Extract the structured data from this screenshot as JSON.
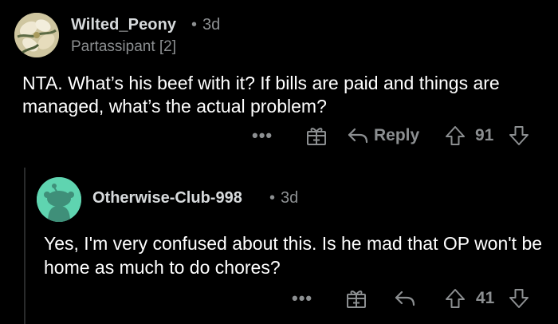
{
  "colors": {
    "background": "#000000",
    "text_primary": "#ffffff",
    "text_secondary": "#8c8f91",
    "reply_avatar_bg": "#5fd4b0"
  },
  "comments": [
    {
      "username": "Wilted_Peony",
      "separator": "•",
      "time": "3d",
      "flair": "Partassipant [2]",
      "body": "NTA. What’s his beef with it? If bills are paid and things are managed, what’s the actual problem?",
      "actions": {
        "more_label": "•••",
        "reply_label": "Reply",
        "vote_count": "91",
        "icons": [
          "more-icon",
          "gift-icon",
          "reply-arrow-icon",
          "upvote-icon",
          "downvote-icon"
        ]
      }
    },
    {
      "username": "Otherwise-Club-998",
      "separator": "•",
      "time": "3d",
      "body": "Yes, I'm very confused about this. Is he mad that OP won't be home as much to do chores?",
      "actions": {
        "more_label": "•••",
        "vote_count": "41",
        "icons": [
          "more-icon",
          "gift-icon",
          "reply-arrow-icon",
          "upvote-icon",
          "downvote-icon"
        ]
      }
    }
  ]
}
